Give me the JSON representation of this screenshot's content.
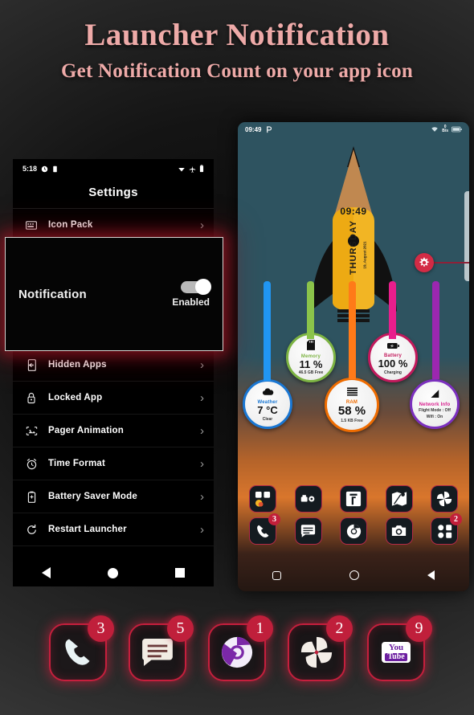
{
  "header": {
    "title": "Launcher Notification",
    "subtitle": "Get Notification Count on your app icon",
    "accent_color": "#eeaaa8"
  },
  "settings_phone": {
    "status_bar": {
      "time": "5:18",
      "left_icons": [
        "clock-icon",
        "sim-icon"
      ],
      "right_icons": [
        "wifi-icon",
        "airplane-icon",
        "battery-icon"
      ]
    },
    "screen_title": "Settings",
    "rows_top": [
      {
        "icon": "keyboard-icon",
        "label": "Icon Pack",
        "chevron": "›"
      }
    ],
    "highlight_card": {
      "label": "Notification",
      "toggle_state": "Enabled",
      "toggle_on": true,
      "border_color": "#d8d4d2",
      "glow_color": "#b2182a"
    },
    "rows_bottom": [
      {
        "icon": "hidden-apps-icon",
        "label": "Hidden Apps",
        "chevron": "›"
      },
      {
        "icon": "lock-icon",
        "label": "Locked App",
        "chevron": "›"
      },
      {
        "icon": "image-icon",
        "label": "Pager Animation",
        "chevron": "›"
      },
      {
        "icon": "alarm-icon",
        "label": "Time Format",
        "chevron": "›"
      },
      {
        "icon": "battery-saver-icon",
        "label": "Battery Saver Mode",
        "chevron": "›"
      },
      {
        "icon": "restart-icon",
        "label": "Restart Launcher",
        "chevron": "›"
      }
    ],
    "nav_bar": [
      "back-icon",
      "home-icon",
      "recents-icon"
    ]
  },
  "home_phone": {
    "status_bar": {
      "time": "09:49",
      "left_icons": [
        "parking-p-icon"
      ],
      "wifi": "wifi-icon",
      "data_rate_value": "0",
      "data_rate_unit": "B/s",
      "battery": "battery-icon"
    },
    "clock_widget": {
      "time": "09:49",
      "day": "THURSDAY",
      "date": "19, August 2021"
    },
    "gear_button": {
      "icon": "gear-icon",
      "color": "#d32b45"
    },
    "widgets": [
      {
        "name": "Memory",
        "icon": "sdcard-icon",
        "value": "11 %",
        "sub": "46.5 GB Free",
        "ring": "#7cb342",
        "pipe": "#8bc34a",
        "name_color": "#7cb342"
      },
      {
        "name": "Battery",
        "icon": "battery-charging-icon",
        "value": "100 %",
        "sub": "Charging",
        "ring": "#c2185b",
        "pipe": "#e91e8c",
        "name_color": "#c2185b"
      },
      {
        "name": "Weather",
        "icon": "cloud-icon",
        "value": "7 °C",
        "sub": "Clear",
        "ring": "#1976d2",
        "pipe": "#2196f3",
        "name_color": "#1976d2"
      },
      {
        "name": "RAM",
        "icon": "list-icon",
        "value": "58 %",
        "sub": "1.5 KB Free",
        "ring": "#ef6c00",
        "pipe": "#ff7a18",
        "name_color": "#ef6c00"
      },
      {
        "name": "Network Info",
        "icon": "signal-icon",
        "value": "",
        "sub": "Flight Mode : Off\nWifi : On",
        "sub_line1": "Flight Mode : Off",
        "sub_line2": "Wifi : On",
        "ring": "#7b2fbe",
        "pipe": "#9c27b0",
        "name_color": "#d81b8c"
      }
    ],
    "dock_row_top": [
      {
        "icon": "folder-apps-icon",
        "label": "",
        "badge": ""
      },
      {
        "icon": "folder-tools-icon",
        "label": "",
        "badge": ""
      },
      {
        "icon": "flipkart-icon",
        "label": "",
        "badge": ""
      },
      {
        "icon": "maps-icon",
        "label": "",
        "badge": ""
      },
      {
        "icon": "photos-pinwheel-icon",
        "label": "",
        "badge": ""
      }
    ],
    "dock_row_bottom": [
      {
        "icon": "phone-icon",
        "badge": "3"
      },
      {
        "icon": "messages-icon",
        "badge": ""
      },
      {
        "icon": "chrome-icon",
        "badge": ""
      },
      {
        "icon": "camera-icon",
        "badge": ""
      },
      {
        "icon": "app-drawer-icon",
        "badge": "2"
      }
    ],
    "nav_bar": [
      "recents-icon",
      "home-icon",
      "back-icon"
    ]
  },
  "showcase_dock": {
    "accent_color": "#c61f3d",
    "items": [
      {
        "icon": "phone-icon",
        "badge": "3"
      },
      {
        "icon": "messages-icon",
        "badge": "5"
      },
      {
        "icon": "chrome-icon",
        "badge": "1"
      },
      {
        "icon": "photos-pinwheel-icon",
        "badge": "2"
      },
      {
        "icon": "youtube-icon",
        "badge": "9",
        "text_top": "You",
        "text_bottom": "Tube"
      }
    ]
  }
}
